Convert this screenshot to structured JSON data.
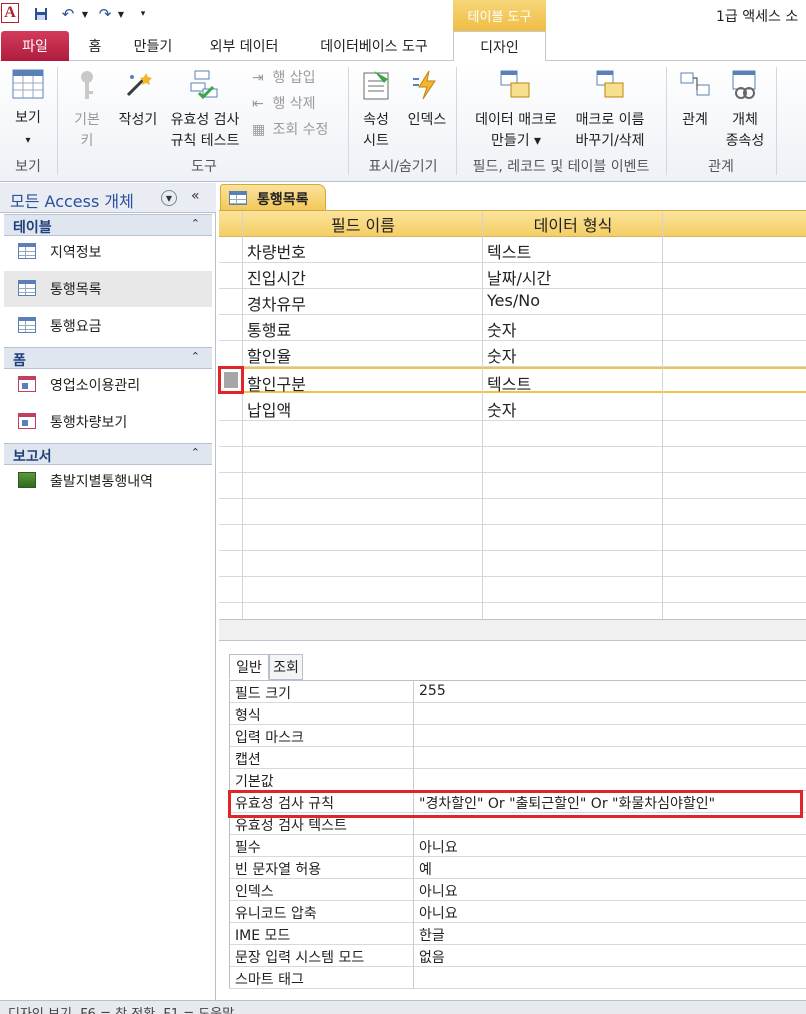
{
  "window": {
    "app_icon": "A",
    "title": "1급 액세스 소",
    "contextual_header": "테이블 도구"
  },
  "quick_access": {
    "save_icon": "floppy-icon",
    "undo_icon": "undo-icon",
    "redo_icon": "redo-icon"
  },
  "tabs": {
    "file": "파일",
    "home": "홈",
    "create": "만들기",
    "external": "외부 데이터",
    "dbtools": "데이터베이스 도구",
    "design": "디자인"
  },
  "ribbon": {
    "view": {
      "line1": "보기",
      "arrow": "▾",
      "group": "보기"
    },
    "primary_key": {
      "line1": "기본",
      "line2": "키"
    },
    "builder": {
      "line1": "작성기"
    },
    "test_rules": {
      "line1": "유효성 검사",
      "line2": "규칙 테스트"
    },
    "insert_rows": "행 삽입",
    "delete_rows": "행 삭제",
    "modify_lookups": "조회 수정",
    "tools_group": "도구",
    "property_sheet": {
      "line1": "속성",
      "line2": "시트"
    },
    "indexes": {
      "line1": "인덱스"
    },
    "showhide_group": "표시/숨기기",
    "create_macros": {
      "line1": "데이터 매크로",
      "line2": "만들기 ▾"
    },
    "rename_macro": {
      "line1": "매크로 이름",
      "line2": "바꾸기/삭제"
    },
    "events_group": "필드, 레코드 및 테이블 이벤트",
    "relationships": {
      "line1": "관계"
    },
    "dependencies": {
      "line1": "개체",
      "line2": "종속성"
    },
    "relationships_group": "관계"
  },
  "nav": {
    "title": "모든 Access 개체",
    "collapse": "«",
    "sections": [
      {
        "label": "테이블",
        "items": [
          "지역정보",
          "통행목록",
          "통행요금"
        ]
      },
      {
        "label": "폼",
        "items": [
          "영업소이용관리",
          "통행차량보기"
        ]
      },
      {
        "label": "보고서",
        "items": [
          "출발지별통행내역"
        ]
      }
    ]
  },
  "document": {
    "tab_label": "통행목록",
    "columns": {
      "field_name": "필드 이름",
      "data_type": "데이터 형식"
    },
    "fields": [
      {
        "name": "차량번호",
        "type": "텍스트"
      },
      {
        "name": "진입시간",
        "type": "날짜/시간"
      },
      {
        "name": "경차유무",
        "type": "Yes/No"
      },
      {
        "name": "통행료",
        "type": "숫자"
      },
      {
        "name": "할인율",
        "type": "숫자"
      },
      {
        "name": "할인구분",
        "type": "텍스트"
      },
      {
        "name": "납입액",
        "type": "숫자"
      }
    ]
  },
  "properties": {
    "tabs": {
      "general": "일반",
      "lookup": "조회"
    },
    "rows": [
      {
        "label": "필드 크기",
        "value": "255"
      },
      {
        "label": "형식",
        "value": ""
      },
      {
        "label": "입력 마스크",
        "value": ""
      },
      {
        "label": "캡션",
        "value": ""
      },
      {
        "label": "기본값",
        "value": ""
      },
      {
        "label": "유효성 검사 규칙",
        "value": "\"경차할인\" Or \"출퇴근할인\" Or \"화물차심야할인\""
      },
      {
        "label": "유효성 검사 텍스트",
        "value": ""
      },
      {
        "label": "필수",
        "value": "아니요"
      },
      {
        "label": "빈 문자열 허용",
        "value": "예"
      },
      {
        "label": "인덱스",
        "value": "아니요"
      },
      {
        "label": "유니코드 압축",
        "value": "아니요"
      },
      {
        "label": "IME 모드",
        "value": "한글"
      },
      {
        "label": "문장 입력 시스템 모드",
        "value": "없음"
      },
      {
        "label": "스마트 태그",
        "value": ""
      }
    ]
  },
  "status": {
    "text": "디자인 보기. F6 = 창 전환. F1 = 도움말."
  },
  "colors": {
    "accent_file_tab": "#b01c3e",
    "context_tab": "#f0bd44",
    "highlight": "#e0242a"
  }
}
